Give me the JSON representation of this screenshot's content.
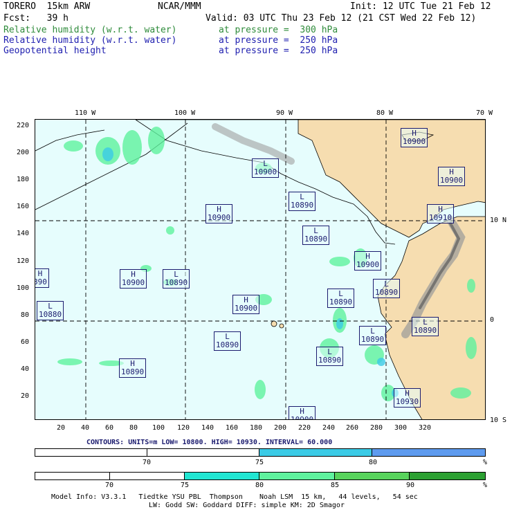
{
  "header": {
    "model": "TORERO  15km ARW",
    "org": "NCAR/MMM",
    "init": "Init: 12 UTC Tue 21 Feb 12",
    "fcst": "Fcst:   39 h",
    "valid": "Valid: 03 UTC Thu 23 Feb 12 (21 CST Wed 22 Feb 12)",
    "fields": [
      {
        "name": "Relative humidity (w.r.t. water)",
        "level": "at pressure =  300 hPa",
        "color": "#2e8b3a"
      },
      {
        "name": "Relative humidity (w.r.t. water)",
        "level": "at pressure =  250 hPa",
        "color": "#2020b0"
      },
      {
        "name": "Geopotential height",
        "level": "at pressure =  250 hPa",
        "color": "#2020b0"
      }
    ]
  },
  "map": {
    "top_lon_labels": [
      "110 W",
      "100 W",
      "90 W",
      "80 W",
      "70 W"
    ],
    "right_lat_labels": [
      "10 N",
      "0",
      "10 S"
    ],
    "y_ticks": [
      "220",
      "200",
      "180",
      "160",
      "140",
      "120",
      "100",
      "80",
      "60",
      "40",
      "20"
    ],
    "x_ticks": [
      "20",
      "40",
      "60",
      "80",
      "100",
      "120",
      "140",
      "160",
      "180",
      "200",
      "220",
      "240",
      "260",
      "280",
      "300",
      "320"
    ],
    "centers": [
      {
        "type": "H",
        "value": "10900"
      },
      {
        "type": "H",
        "value": "10900"
      },
      {
        "type": "L",
        "value": "10900"
      },
      {
        "type": "L",
        "value": "10890"
      },
      {
        "type": "H",
        "value": "10900"
      },
      {
        "type": "H",
        "value": "10910"
      },
      {
        "type": "L",
        "value": "10890"
      },
      {
        "type": "H",
        "value": "10900"
      },
      {
        "type": "H",
        "value": "890"
      },
      {
        "type": "H",
        "value": "10900"
      },
      {
        "type": "L",
        "value": "10890"
      },
      {
        "type": "L",
        "value": "10890"
      },
      {
        "type": "L",
        "value": "10890"
      },
      {
        "type": "H",
        "value": "10900"
      },
      {
        "type": "L",
        "value": "10880"
      },
      {
        "type": "L",
        "value": "10890"
      },
      {
        "type": "L",
        "value": "10890"
      },
      {
        "type": "L",
        "value": "10890"
      },
      {
        "type": "H",
        "value": "10890"
      },
      {
        "type": "L",
        "value": "10890"
      },
      {
        "type": "H",
        "value": "10930"
      },
      {
        "type": "H",
        "value": "10900"
      }
    ]
  },
  "contours_text": "CONTOURS:  UNITS=m  LOW=  10800.     HIGH=  10930.     INTERVAL=   60.000",
  "scale1": {
    "labels": [
      "70",
      "75",
      "80"
    ],
    "unit": "%",
    "colors": [
      "#ffffff",
      "#ffffff",
      "#3bcbe6",
      "#5e9bef"
    ]
  },
  "scale2": {
    "labels": [
      "70",
      "75",
      "80",
      "85",
      "90"
    ],
    "unit": "%",
    "colors": [
      "#ffffff",
      "#ffffff",
      "#21e6d2",
      "#5ff29e",
      "#58d35c",
      "#2ca032"
    ]
  },
  "footer": {
    "line1": "Model Info: V3.3.1   Tiedtke YSU PBL  Thompson    Noah LSM  15 km,   44 levels,   54 sec",
    "line2": "LW: Godd SW: Goddard DIFF: simple KM: 2D Smagor"
  }
}
